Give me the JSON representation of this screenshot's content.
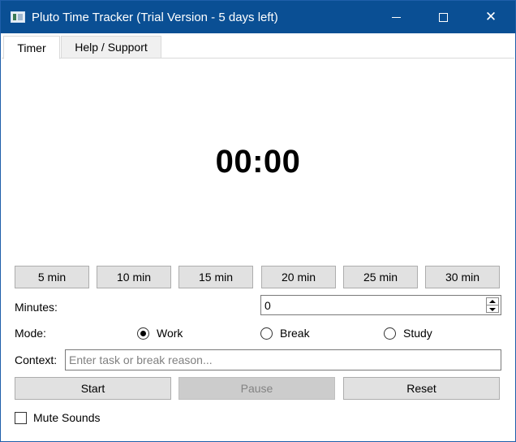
{
  "window": {
    "title": "Pluto Time Tracker (Trial Version - 5 days left)",
    "controls": {
      "minimize": "minimize",
      "maximize": "maximize",
      "close": "✕"
    }
  },
  "tabs": [
    {
      "label": "Timer",
      "selected": true
    },
    {
      "label": "Help / Support",
      "selected": false
    }
  ],
  "timer": {
    "display": "00:00"
  },
  "presets": [
    "5 min",
    "10 min",
    "15 min",
    "20 min",
    "25 min",
    "30 min"
  ],
  "minutes": {
    "label": "Minutes:",
    "value": "0"
  },
  "mode": {
    "label": "Mode:",
    "options": [
      {
        "label": "Work",
        "selected": true
      },
      {
        "label": "Break",
        "selected": false
      },
      {
        "label": "Study",
        "selected": false
      }
    ]
  },
  "context": {
    "label": "Context:",
    "value": "",
    "placeholder": "Enter task or break reason..."
  },
  "actions": {
    "start": "Start",
    "pause": "Pause",
    "reset": "Reset"
  },
  "mute": {
    "label": "Mute Sounds",
    "checked": false
  },
  "colors": {
    "titlebar": "#0a4f94",
    "button": "#e1e1e1",
    "disabled_button": "#cccccc"
  }
}
